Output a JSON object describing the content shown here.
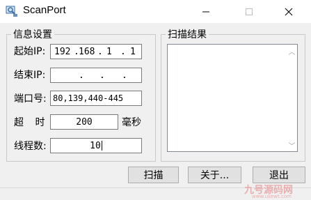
{
  "window": {
    "title": "ScanPort",
    "icon": "scanner-app-icon"
  },
  "controls": {
    "minimize": "minimize-icon",
    "maximize": "maximize-icon",
    "close": "close-icon"
  },
  "info_group": {
    "title": "信息设置",
    "start_ip": {
      "label": "起始IP:",
      "octets": [
        "192",
        "168",
        "1",
        "1"
      ]
    },
    "end_ip": {
      "label": "结束IP:",
      "octets": [
        "",
        "",
        "",
        ""
      ]
    },
    "ports": {
      "label": "端口号:",
      "value": "80,139,440-445"
    },
    "timeout": {
      "label": "超  时:",
      "value": "200",
      "unit": "毫秒"
    },
    "threads": {
      "label": "线程数:",
      "value": "10"
    }
  },
  "results_group": {
    "title": "扫描结果"
  },
  "buttons": {
    "scan": "扫描",
    "about": "关于...",
    "exit": "退出"
  },
  "watermark": {
    "text": "九号源码网",
    "sub": "www.ukewt.com"
  }
}
